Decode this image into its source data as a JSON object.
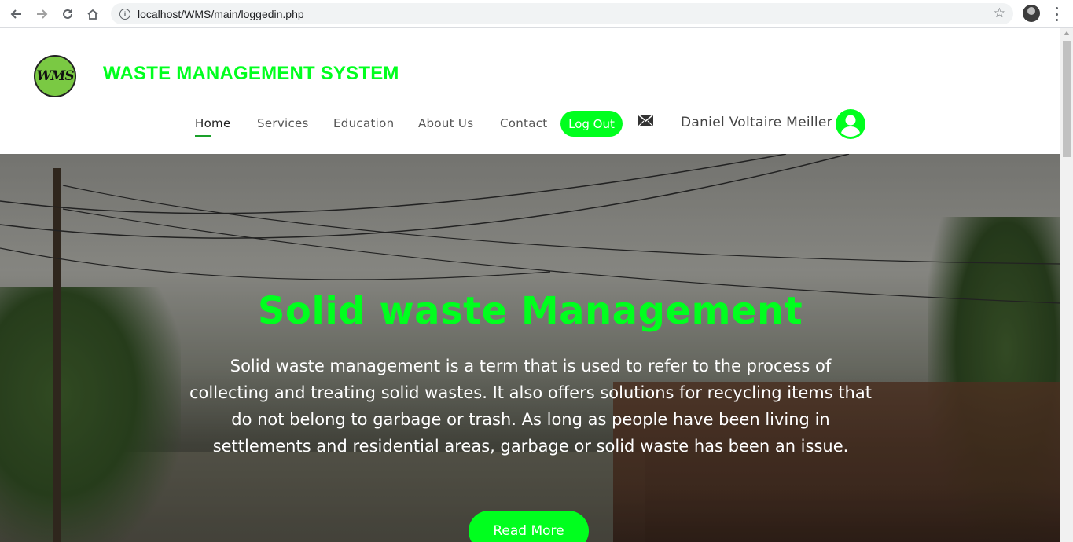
{
  "browser": {
    "url": "localhost/WMS/main/loggedin.php"
  },
  "header": {
    "logo_text": "WMS",
    "brand": "WASTE MANAGEMENT SYSTEM",
    "nav": [
      {
        "label": "Home"
      },
      {
        "label": "Services"
      },
      {
        "label": "Education"
      },
      {
        "label": "About Us"
      },
      {
        "label": "Contact"
      }
    ],
    "logout_label": "Log Out",
    "username": "Daniel Voltaire Meiller"
  },
  "hero": {
    "title": "Solid waste Management",
    "text": "Solid waste management is a term that is used to refer to the process of collecting and treating solid wastes. It also offers solutions for recycling items that do not belong to garbage or trash. As long as people have been living in settlements and residential areas, garbage or solid waste has been an issue.",
    "button_label": "Read More"
  },
  "colors": {
    "accent": "#00ff1e"
  }
}
